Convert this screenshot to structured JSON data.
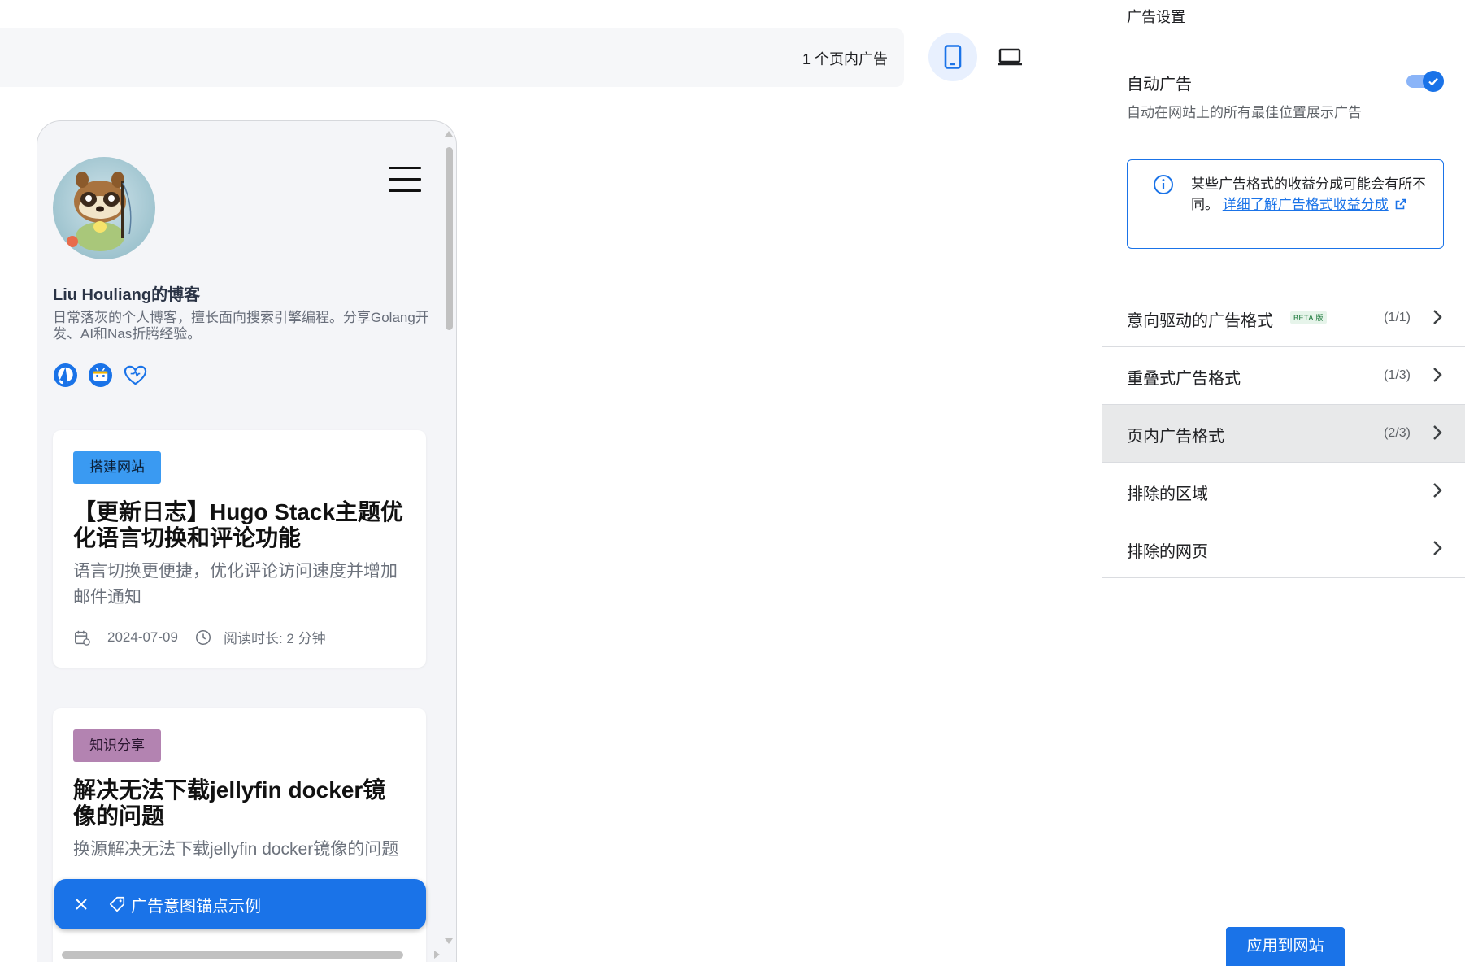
{
  "preview": {
    "ad_count_label": "1 个页内广告",
    "device_mobile_icon": "smartphone-icon",
    "device_desktop_icon": "laptop-icon"
  },
  "blog": {
    "title": "Liu Houliang的博客",
    "description": "日常落灰的个人博客，擅长面向搜索引擎编程。分享Golang开发、AI和Nas折腾经验。",
    "socials": [
      "github-icon",
      "bilibili-icon",
      "heart-icon"
    ]
  },
  "posts": [
    {
      "tag": "搭建网站",
      "tag_color": "#3a9af2",
      "title": "【更新日志】Hugo Stack主题优化语言切换和评论功能",
      "subtitle": "语言切换更便捷，优化评论访问速度并增加邮件通知",
      "date": "2024-07-09",
      "read_time": "阅读时长: 2 分钟"
    },
    {
      "tag": "知识分享",
      "tag_color": "#b383b1",
      "title": "解决无法下载jellyfin docker镜像的问题",
      "subtitle": "换源解决无法下载jellyfin docker镜像的问题"
    }
  ],
  "anchor_bar": {
    "label": "广告意图锚点示例"
  },
  "panel": {
    "header": "广告设置",
    "auto_ads": {
      "title": "自动广告",
      "enabled": true,
      "description": "自动在网站上的所有最佳位置展示广告"
    },
    "info": {
      "text": "某些广告格式的收益分成可能会有所不同。",
      "link": "详细了解广告格式收益分成"
    },
    "menu": [
      {
        "label": "意向驱动的广告格式",
        "beta": "BETA 版",
        "count": "(1/1)"
      },
      {
        "label": "重叠式广告格式",
        "count": "(1/3)"
      },
      {
        "label": "页内广告格式",
        "count": "(2/3)",
        "active": true
      },
      {
        "label": "排除的区域"
      },
      {
        "label": "排除的网页"
      }
    ],
    "apply_button": "应用到网站"
  },
  "colors": {
    "accent": "#1a73e8",
    "panel_active": "#e8e9ea"
  }
}
